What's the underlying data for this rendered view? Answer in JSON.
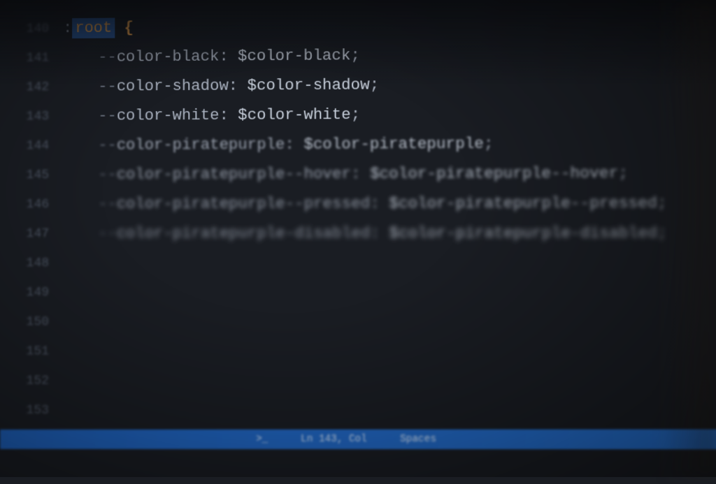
{
  "gutter": {
    "lines": [
      "140",
      "141",
      "142",
      "143",
      "144",
      "145",
      "146",
      "147",
      "148",
      "149",
      "150",
      "151",
      "152",
      "153"
    ]
  },
  "code": {
    "line143": {
      "selector_prefix": ":",
      "selector": "root",
      "brace": " {"
    },
    "line144": {
      "prefix": "--",
      "prop": "color-black",
      "colon": ": ",
      "value": "$color-black",
      "semi": ";"
    },
    "line145": {
      "prefix": "--",
      "prop": "color-shadow",
      "colon": ": ",
      "value": "$color-shadow",
      "semi": ";"
    },
    "line147": {
      "prefix": "--",
      "prop": "color-white",
      "colon": ": ",
      "value": "$color-white",
      "semi": ";"
    },
    "line149": {
      "prefix": "--",
      "prop": "color-piratepurple",
      "colon": ": ",
      "value": "$color-piratepurple",
      "semi": ";"
    },
    "line150": {
      "prefix": "--",
      "prop": "color-piratepurple--hover",
      "colon": ": ",
      "value": "$color-piratepurple--hover",
      "semi": ";"
    },
    "line151": {
      "prefix": "--",
      "prop": "color-piratepurple--pressed",
      "colon": ": ",
      "value": "$color-piratepurple--pressed",
      "semi": ";"
    },
    "line152": {
      "prefix": "--",
      "prop": "color-piratepurple-disabled",
      "colon": ": ",
      "value": "$color-piratepurple-disabled",
      "semi": ";"
    }
  },
  "statusbar": {
    "terminal": ">_",
    "position": "Ln 143, Col ",
    "spaces": "Spaces ",
    "encoding": "  "
  }
}
